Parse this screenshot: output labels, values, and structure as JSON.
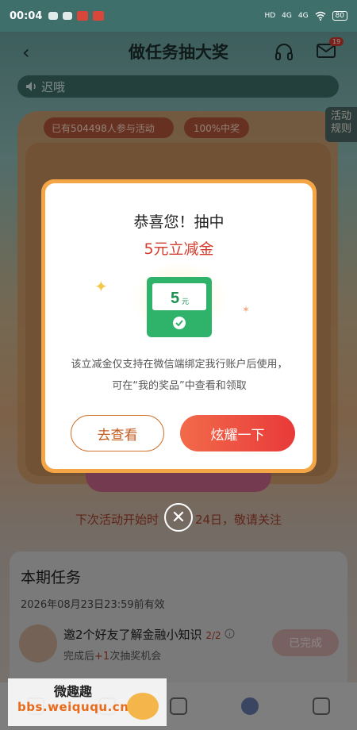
{
  "status_bar": {
    "time": "00:04",
    "network_labels": [
      "HD",
      "4G",
      "4G"
    ],
    "battery": "80"
  },
  "header": {
    "title": "做任务抽大奖",
    "mail_badge": "19"
  },
  "notice": {
    "text": "迟哦"
  },
  "side_tab": {
    "line1": "活动",
    "line2": "规则"
  },
  "machine": {
    "participants": "已有504498人参与活动",
    "win_rate": "100%中奖"
  },
  "next_activity": {
    "before_gap": "下次活动开始时",
    "after_gap": "24日，敬请关注"
  },
  "tasks": {
    "title": "本期任务",
    "valid_until": "2026年08月23日23:59前有效",
    "items": [
      {
        "name": "邀2个好友了解金融小知识",
        "progress": "2/2",
        "reward_prefix": "完成后",
        "reward_plus": "+1",
        "reward_suffix": "次抽奖机会",
        "status": "已完成"
      }
    ]
  },
  "watermark": {
    "line1": "微趣趣",
    "line2": "bbs.weiququ.cn"
  },
  "modal": {
    "title": "恭喜您！抽中",
    "prize": "5元立减金",
    "coupon_amount": "5",
    "coupon_unit": "元",
    "desc_line1": "该立减金仅支持在微信端绑定我行账户后使用，",
    "desc_line2": "可在“我的奖品”中查看和领取",
    "btn_view": "去查看",
    "btn_share": "炫耀一下"
  },
  "colors": {
    "accent_red": "#d43b2c",
    "modal_frame": "#f4a646",
    "share_gradient_start": "#f26a4a",
    "share_gradient_end": "#e83a3a"
  }
}
